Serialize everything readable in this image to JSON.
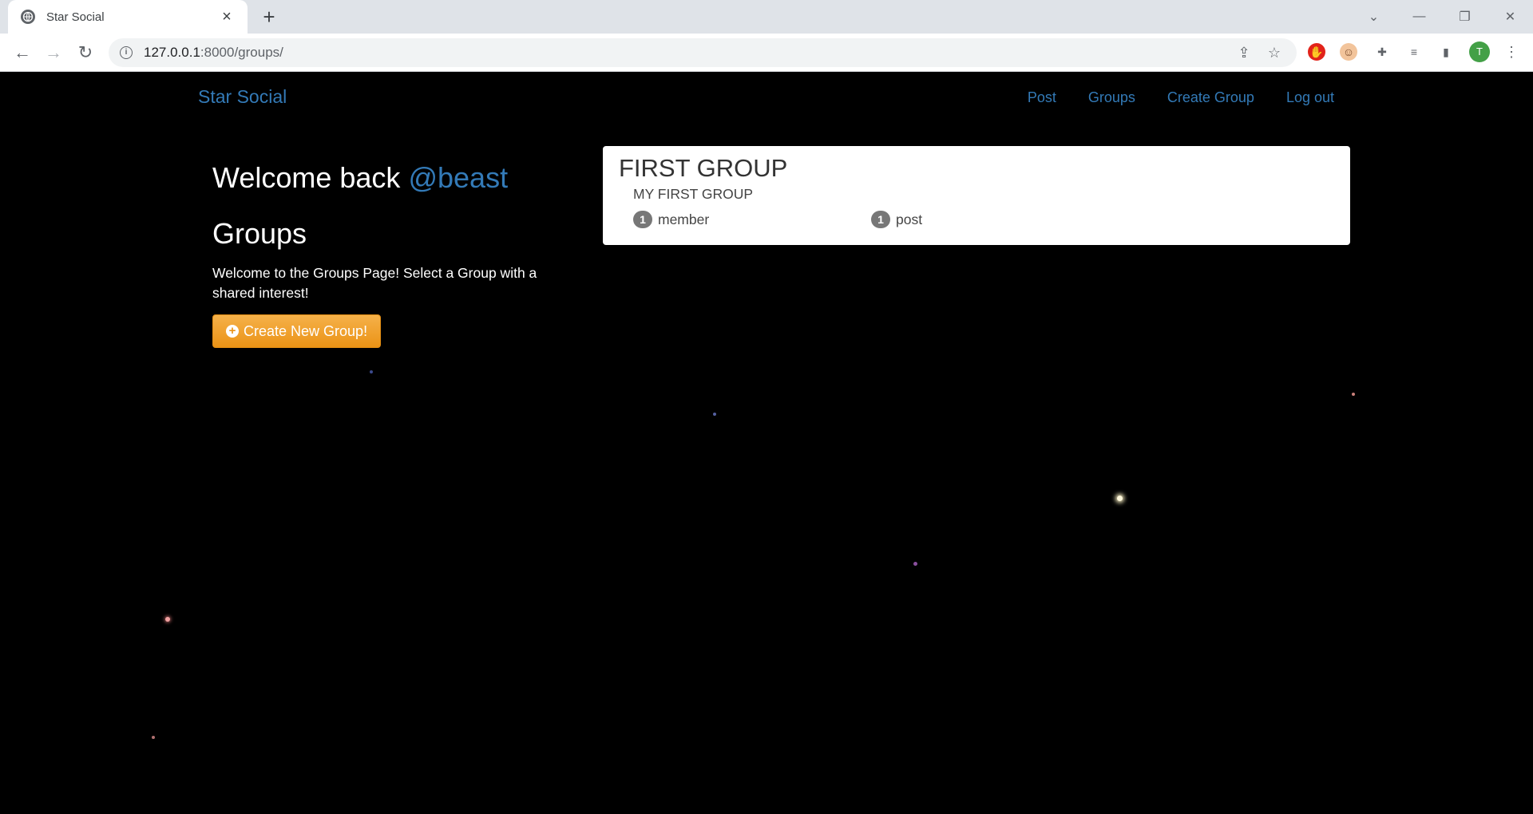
{
  "browser": {
    "tab_title": "Star Social",
    "url_host": "127.0.0.1",
    "url_path": ":8000/groups/",
    "profile_initial": "T"
  },
  "navbar": {
    "brand": "Star Social",
    "links": [
      "Post",
      "Groups",
      "Create Group",
      "Log out"
    ]
  },
  "sidebar": {
    "welcome_prefix": "Welcome back",
    "username": "@beast",
    "heading": "Groups",
    "intro": "Welcome to the Groups Page! Select a Group with a shared interest!",
    "create_button": "Create New Group!"
  },
  "groups": [
    {
      "name": "FIRST GROUP",
      "description": "MY FIRST GROUP",
      "member_count": "1",
      "member_label": "member",
      "post_count": "1",
      "post_label": "post"
    }
  ],
  "colors": {
    "link": "#337ab7",
    "button": "#f0ad4e",
    "background": "#000000"
  }
}
